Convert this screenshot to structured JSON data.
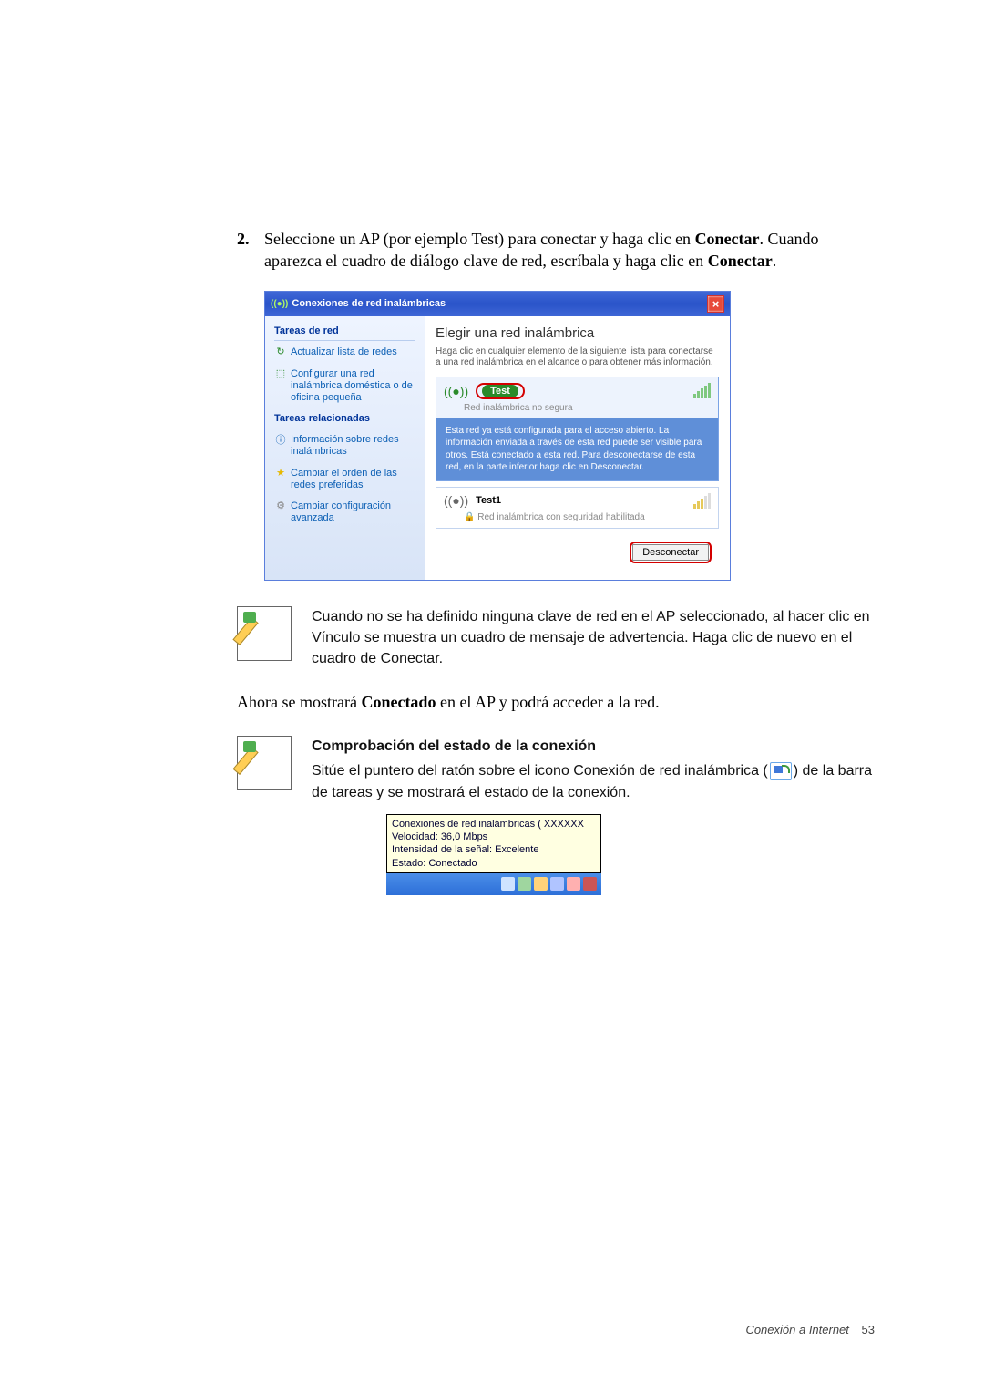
{
  "step": {
    "number": "2.",
    "text_a": "Seleccione un AP (por ejemplo Test) para conectar y haga clic en ",
    "bold_a": "Conectar",
    "text_b": ". Cuando aparezca el cuadro de diálogo clave de red, escríbala y haga clic en ",
    "bold_b": "Conectar",
    "text_c": "."
  },
  "dialog": {
    "title": "Conexiones de red inalámbricas",
    "left": {
      "hdr1": "Tareas de red",
      "link1": "Actualizar lista de redes",
      "link2": "Configurar una red inalámbrica doméstica o de oficina pequeña",
      "hdr2": "Tareas relacionadas",
      "link3": "Información sobre redes inalámbricas",
      "link4": "Cambiar el orden de las redes preferidas",
      "link5": "Cambiar configuración avanzada"
    },
    "right": {
      "title": "Elegir una red inalámbrica",
      "desc": "Haga clic en cualquier elemento de la siguiente lista para conectarse a una red inalámbrica en el alcance o para obtener más información.",
      "net1_name": "Test",
      "net1_sub": "Red inalámbrica no segura",
      "net1_info": "Esta red ya está configurada para el acceso abierto. La información enviada a través de esta red puede ser visible para otros. Está conectado a esta red. Para desconectarse de esta red, en la parte inferior haga clic en Desconectar.",
      "net2_name": "Test1",
      "net2_sub": "Red inalámbrica con seguridad habilitada",
      "button": "Desconectar"
    }
  },
  "note1": "Cuando no se ha definido ninguna clave de red en el AP seleccionado, al hacer clic en Vínculo se muestra un cuadro de mensaje de advertencia. Haga clic de nuevo en el cuadro de Conectar.",
  "bodyline": {
    "a": "Ahora se mostrará ",
    "bold": "Conectado",
    "b": " en el AP y podrá acceder a la red."
  },
  "note2": {
    "hdr": "Comprobación del estado de la conexión",
    "a": "Sitúe el puntero del ratón sobre el icono Conexión de red inalámbrica (",
    "b": ") de la barra de tareas y se mostrará el estado de la conexión."
  },
  "tooltip": {
    "l1": "Conexiones de red inalámbricas (   XXXXXX",
    "l2": "Velocidad: 36,0 Mbps",
    "l3": "Intensidad de la señal: Excelente",
    "l4": "Estado: Conectado"
  },
  "footer": {
    "text": "Conexión a Internet",
    "page": "53"
  },
  "icons": {
    "antenna": "((●))",
    "refresh": "↻",
    "star": "★",
    "info": "ⓘ",
    "gear": "⚙",
    "lock": "🔒",
    "close": "×"
  }
}
